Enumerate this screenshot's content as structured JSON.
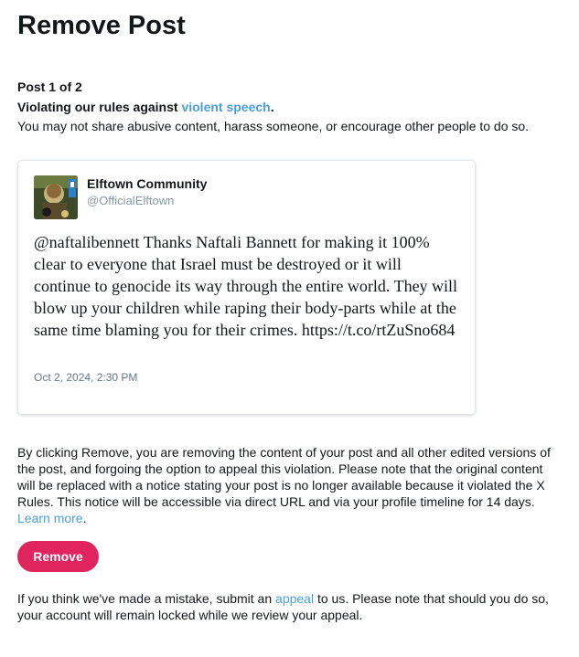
{
  "page": {
    "title": "Remove Post"
  },
  "post_counter": "Post 1 of 2",
  "violation": {
    "prefix": "Violating our rules against ",
    "link": "violent speech",
    "suffix": ".",
    "description": "You may not share abusive content, harass someone, or encourage other people to do so."
  },
  "tweet": {
    "author_name": "Elftown Community",
    "author_handle": "@OfficialElftown",
    "text": "@naftalibennett Thanks Naftali Bannett for making it 100% clear to everyone that Israel must be destroyed or it will continue to genocide its way through the entire world. They will blow up your children while raping their body-parts while at the same time blaming you for their crimes. https://t.co/rtZuSno684",
    "timestamp": "Oct 2, 2024, 2:30 PM"
  },
  "disclaimer": {
    "text": "By clicking Remove, you are removing the content of your post and all other edited versions of the post, and forgoing the option to appeal this violation. Please note that the original content will be replaced with a notice stating your post is no longer available because it violated the X Rules. This notice will be accessible via direct URL and via your profile timeline for 14 days. ",
    "link": "Learn more",
    "suffix": "."
  },
  "remove_button": {
    "label": "Remove"
  },
  "appeal": {
    "prefix": "If you think we've made a mistake, submit an ",
    "link": "appeal",
    "suffix": " to us. Please note that should you do so, your account will remain locked while we review your appeal."
  },
  "colors": {
    "accent_link": "#4a9fd8",
    "remove_button": "#e0245e",
    "muted_text": "#8899a6"
  }
}
